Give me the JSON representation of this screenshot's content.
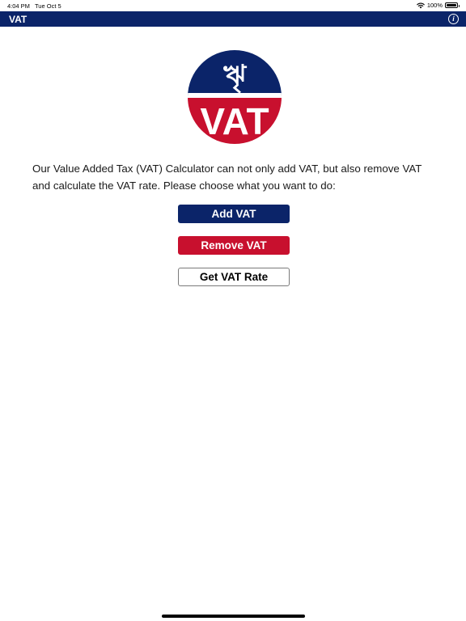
{
  "status_bar": {
    "time": "4:04 PM",
    "date": "Tue Oct 5",
    "battery": "100%",
    "battery_level": 1.0
  },
  "nav": {
    "title": "VAT",
    "info_label": "i"
  },
  "logo": {
    "symbol": "ৠ",
    "text": "VAT"
  },
  "intro": {
    "text": "Our Value Added Tax (VAT) Calculator can not only add VAT, but also remove VAT and calculate the VAT rate. Please choose what you want to do:"
  },
  "buttons": {
    "add_vat": "Add VAT",
    "remove_vat": "Remove VAT",
    "get_vat_rate": "Get VAT Rate"
  },
  "colors": {
    "navy": "#0b2469",
    "red": "#c8102e",
    "white": "#ffffff"
  }
}
